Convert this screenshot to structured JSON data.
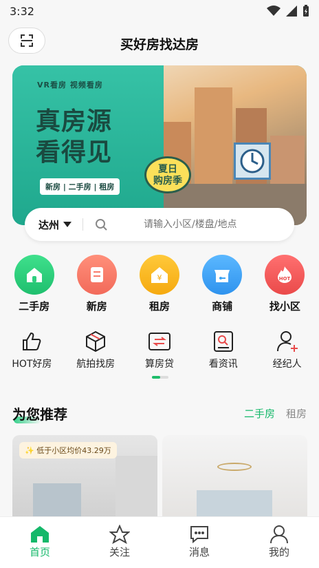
{
  "status": {
    "time": "3:32"
  },
  "header": {
    "title": "买好房找达房"
  },
  "banner": {
    "vr_text": "VR看房  视频看房",
    "line1": "真房源",
    "line2": "看得见",
    "pill": "新房 | 二手房 | 租房",
    "summer_line1": "夏日",
    "summer_line2": "购房季"
  },
  "search": {
    "city": "达州",
    "placeholder": "请输入小区/楼盘/地点"
  },
  "categories": [
    {
      "label": "二手房",
      "color": "#2fce7e",
      "icon": "home-icon"
    },
    {
      "label": "新房",
      "color": "#f87b6b",
      "icon": "document-icon"
    },
    {
      "label": "租房",
      "color": "#f8b91f",
      "icon": "yen-house-icon"
    },
    {
      "label": "商铺",
      "color": "#3da4f4",
      "icon": "shop-icon"
    },
    {
      "label": "找小区",
      "color": "#f45a5a",
      "icon": "hot-fire-icon"
    }
  ],
  "tools": [
    {
      "label": "HOT好房",
      "icon": "thumbs-up-icon"
    },
    {
      "label": "航拍找房",
      "icon": "cube-icon"
    },
    {
      "label": "算房贷",
      "icon": "calculator-icon"
    },
    {
      "label": "看资讯",
      "icon": "news-icon"
    },
    {
      "label": "经纪人",
      "icon": "agent-icon"
    }
  ],
  "recommend": {
    "title": "为您推荐",
    "tab_active": "二手房",
    "tab_other": "租房",
    "card1_badge": "低于小区均价43.29万"
  },
  "tabbar": [
    {
      "label": "首页",
      "active": true
    },
    {
      "label": "关注",
      "active": false
    },
    {
      "label": "消息",
      "active": false
    },
    {
      "label": "我的",
      "active": false
    }
  ],
  "colors": {
    "accent": "#15b86a"
  }
}
